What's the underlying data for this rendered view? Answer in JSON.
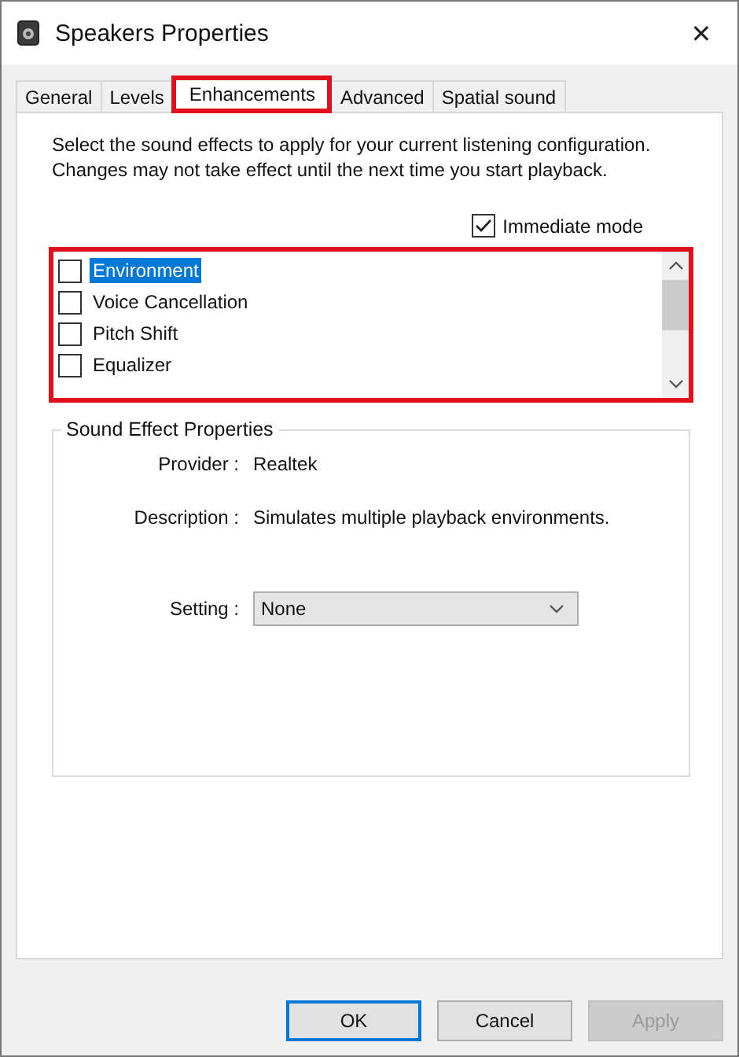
{
  "window": {
    "title": "Speakers Properties",
    "close": "✕"
  },
  "tabs": [
    {
      "label": "General",
      "selected": false,
      "highlighted": false
    },
    {
      "label": "Levels",
      "selected": false,
      "highlighted": false
    },
    {
      "label": "Enhancements",
      "selected": true,
      "highlighted": true
    },
    {
      "label": "Advanced",
      "selected": false,
      "highlighted": false
    },
    {
      "label": "Spatial sound",
      "selected": false,
      "highlighted": false
    }
  ],
  "intro": "Select the sound effects to apply for your current listening configuration. Changes may not take effect until the next time you start playback.",
  "immediate_mode": {
    "label": "Immediate mode",
    "checked": true
  },
  "effects_list": {
    "highlighted": true,
    "items": [
      {
        "label": "Environment",
        "checked": false,
        "selected": true
      },
      {
        "label": "Voice Cancellation",
        "checked": false,
        "selected": false
      },
      {
        "label": "Pitch Shift",
        "checked": false,
        "selected": false
      },
      {
        "label": "Equalizer",
        "checked": false,
        "selected": false
      }
    ]
  },
  "properties": {
    "title": "Sound Effect Properties",
    "provider": {
      "label": "Provider :",
      "value": "Realtek"
    },
    "description": {
      "label": "Description :",
      "value": "Simulates multiple playback environments."
    },
    "setting": {
      "label": "Setting :",
      "value": "None"
    }
  },
  "buttons": [
    {
      "label": "OK",
      "default": true,
      "disabled": false
    },
    {
      "label": "Cancel",
      "default": false,
      "disabled": false
    },
    {
      "label": "Apply",
      "default": false,
      "disabled": true
    }
  ]
}
